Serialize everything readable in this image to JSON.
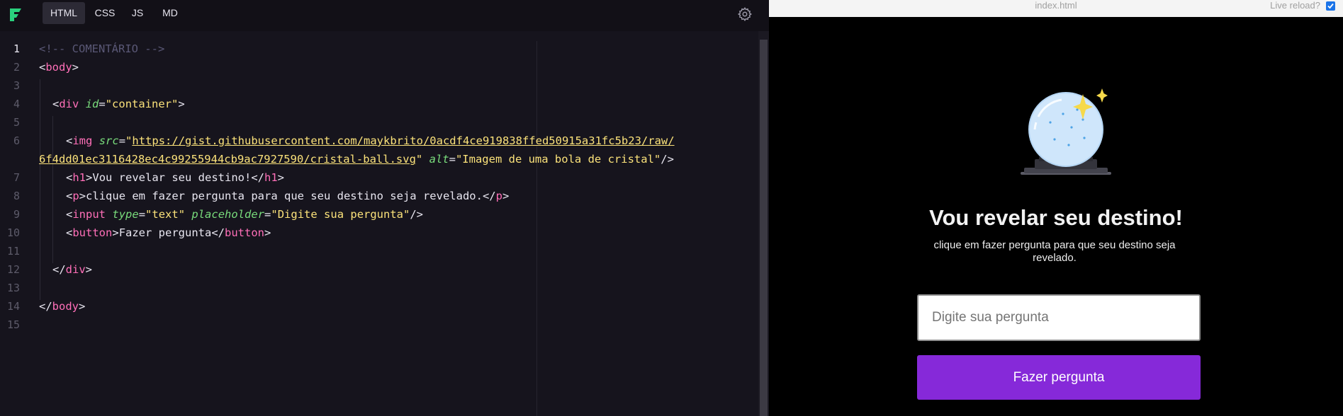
{
  "editor": {
    "tabs": [
      {
        "label": "HTML",
        "active": true
      },
      {
        "label": "CSS",
        "active": false
      },
      {
        "label": "JS",
        "active": false
      },
      {
        "label": "MD",
        "active": false
      }
    ],
    "current_line": 1,
    "line_numbers": [
      "1",
      "2",
      "3",
      "4",
      "5",
      "6",
      "",
      "7",
      "8",
      "9",
      "10",
      "11",
      "12",
      "13",
      "14",
      "15"
    ],
    "code": {
      "l1_comment": "<!-- COMENTÁRIO -->",
      "body_tag": "body",
      "div_tag": "div",
      "div_attr": "id",
      "div_val": "\"container\"",
      "img_tag": "img",
      "img_src_attr": "src",
      "img_src_part1": "https://gist.githubusercontent.com/maykbrito/0acdf4ce919838ffed50915a31fc5b23/raw/",
      "img_src_part2": "6f4dd01ec3116428ec4c99255944cb9ac7927590/cristal-ball.svg",
      "img_alt_attr": "alt",
      "img_alt_val": "\"Imagem de uma bola de cristal\"",
      "h1_tag": "h1",
      "h1_text": "Vou revelar seu destino!",
      "p_tag": "p",
      "p_text": "clique em fazer pergunta para que seu destino seja revelado.",
      "input_tag": "input",
      "input_type_attr": "type",
      "input_type_val": "\"text\"",
      "input_ph_attr": "placeholder",
      "input_ph_val": "\"Digite sua pergunta\"",
      "button_tag": "button",
      "button_text": "Fazer pergunta"
    },
    "icons": {
      "logo": "app-logo-icon",
      "settings": "gear-icon"
    },
    "accent": "#2ad07d"
  },
  "preview": {
    "file_name": "index.html",
    "live_reload_label": "Live reload?",
    "live_reload_checked": true,
    "heading": "Vou revelar seu destino!",
    "description": "clique em fazer pergunta para que seu destino seja revelado.",
    "input_placeholder": "Digite sua pergunta",
    "input_value": "",
    "button_label": "Fazer pergunta",
    "button_color": "#8629d9",
    "image_alt": "Imagem de uma bola de cristal"
  }
}
